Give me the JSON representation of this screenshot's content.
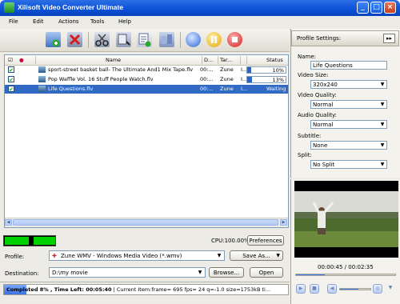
{
  "window": {
    "title": "Xilisoft Video Converter Ultimate",
    "min": "_",
    "max": "□",
    "close": "×"
  },
  "menu": [
    "File",
    "Edit",
    "Actions",
    "Tools",
    "Help"
  ],
  "toolbar": {
    "icons": [
      "add-file-icon",
      "remove-file-icon",
      "cut-icon",
      "clip-icon",
      "add-profile-icon",
      "merge-icon",
      "convert-icon",
      "pause-icon",
      "stop-icon"
    ]
  },
  "list": {
    "columns": {
      "check": "",
      "name": "Name",
      "duration": "D...",
      "target": "Tar...",
      "extra": "",
      "status": "Status"
    },
    "rows": [
      {
        "name": "sport-street basket ball- The Ultimate And1 Mix Tape.flv",
        "duration": "00:...",
        "target": "Zune",
        "extra": "I...",
        "status": "10%",
        "progress": 0.1,
        "selected": false
      },
      {
        "name": "Pop Waffle Vol. 16  Stuff People Watch.flv",
        "duration": "00:...",
        "target": "Zune",
        "extra": "I...",
        "status": "13%",
        "progress": 0.13,
        "selected": false
      },
      {
        "name": "Life Questions.flv",
        "duration": "00:...",
        "target": "Zune",
        "extra": "I...",
        "status": "Waiting",
        "progress": 0,
        "selected": true
      }
    ]
  },
  "cpu": {
    "text": "CPU:100.00%",
    "preferences_label": "Preferences"
  },
  "profile": {
    "label": "Profile:",
    "value": "Zune WMV - Windows Media Video (*.wmv)",
    "save_as_label": "Save As..."
  },
  "destination": {
    "label": "Destination:",
    "value": "D:\\my movie",
    "browse_label": "Browse...",
    "open_label": "Open"
  },
  "status": {
    "bold": "Completed 8% , Time Left: 00:05:40",
    "rest": "| Current Item:frame=   695 fps= 24 q=-1.0 size=1753kB ti...",
    "progress": 0.08
  },
  "settings": {
    "header": "Profile Settings:",
    "expand": "▸▸",
    "name_label": "Name:",
    "name_value": "Life Questions",
    "video_size_label": "Video Size:",
    "video_size_value": "320x240",
    "video_quality_label": "Video Quality:",
    "video_quality_value": "Normal",
    "audio_quality_label": "Audio Quality:",
    "audio_quality_value": "Normal",
    "subtitle_label": "Subtitle:",
    "subtitle_value": "None",
    "split_label": "Split:",
    "split_value": "No Split"
  },
  "preview": {
    "time": "00:00:45 / 00:02:35",
    "progress": 0.29,
    "volume": 0.6
  }
}
